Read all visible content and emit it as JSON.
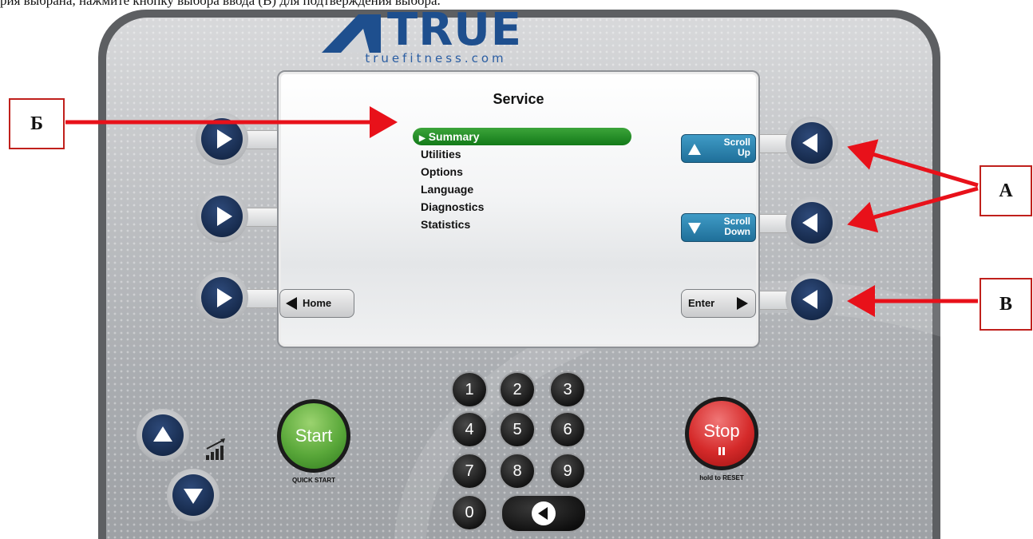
{
  "caption": "рия выбрана, нажмите кнопку выбора ввода (В) для подтверждения выбора.",
  "logo": {
    "word": "TRUE",
    "url": "truefitness.com"
  },
  "screen": {
    "title": "Service",
    "menu": [
      {
        "label": "Summary",
        "selected": true
      },
      {
        "label": "Utilities"
      },
      {
        "label": "Options"
      },
      {
        "label": "Language"
      },
      {
        "label": "Diagnostics"
      },
      {
        "label": "Statistics"
      }
    ],
    "scroll_up": {
      "line1": "Scroll",
      "line2": "Up"
    },
    "scroll_down": {
      "line1": "Scroll",
      "line2": "Down"
    },
    "home": "Home",
    "enter": "Enter"
  },
  "keypad": [
    "1",
    "2",
    "3",
    "4",
    "5",
    "6",
    "7",
    "8",
    "9",
    "0"
  ],
  "start": {
    "label": "Start",
    "sub": "QUICK START"
  },
  "stop": {
    "label": "Stop",
    "sub": "hold to RESET"
  },
  "annotations": {
    "a": "А",
    "b": "Б",
    "v": "В"
  },
  "colors": {
    "arrow": "#e8111a",
    "selection": "#1f8a24",
    "logo": "#1e4f8e",
    "button_core": "#172b4d"
  },
  "icons": {
    "left_buttons": "play-right-icon",
    "right_buttons": "play-left-icon",
    "incline": "incline-icon"
  }
}
